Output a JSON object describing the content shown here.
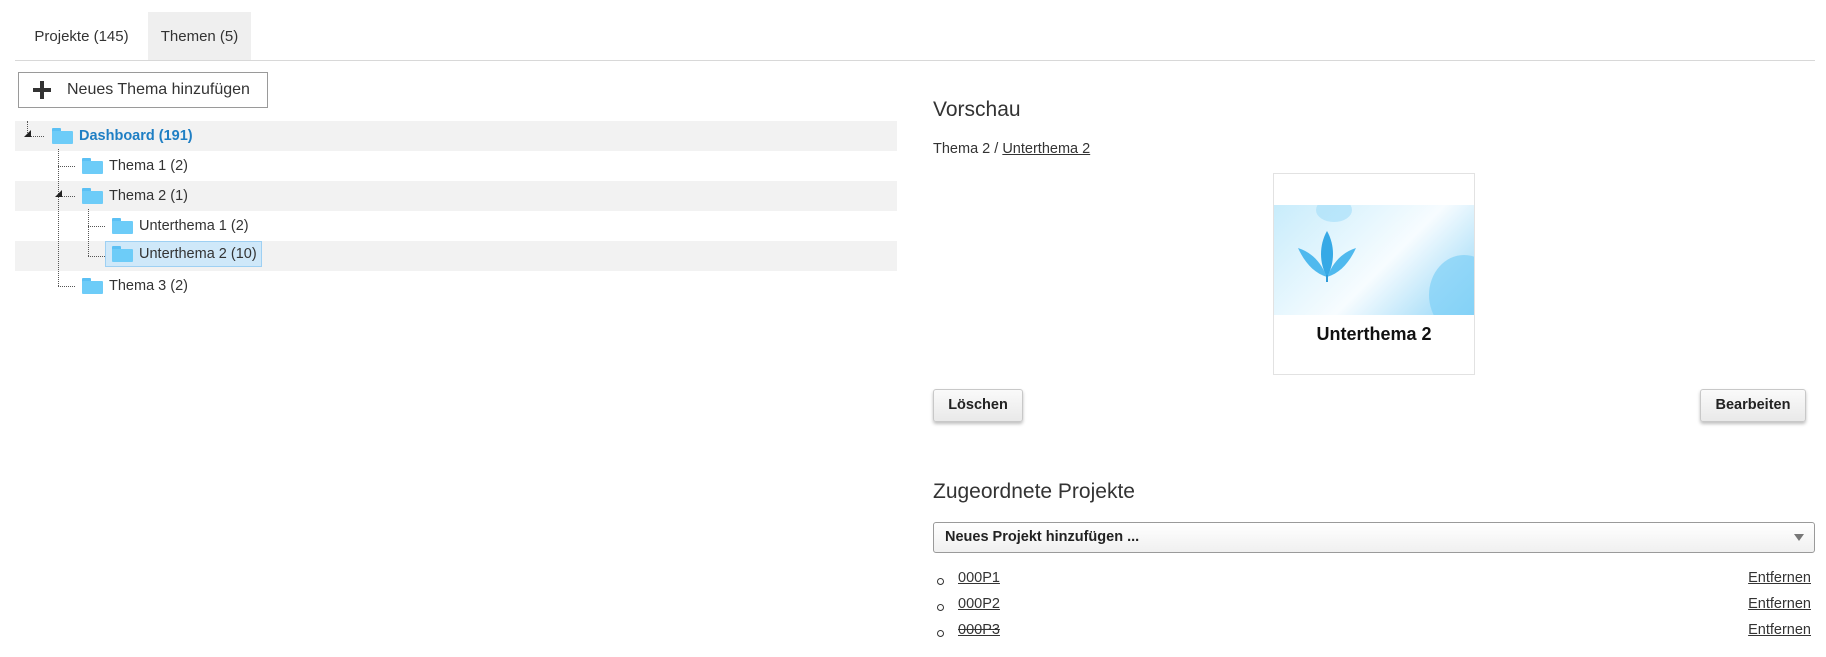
{
  "tabs": [
    {
      "label": "Projekte (145)"
    },
    {
      "label": "Themen (5)",
      "active": true
    }
  ],
  "add_topic_button": {
    "label": "Neues Thema hinzufügen"
  },
  "tree": {
    "root": {
      "label": "Dashboard (191)"
    },
    "nodes": [
      {
        "label": "Thema 1 (2)"
      },
      {
        "label": "Thema 2 (1)"
      },
      {
        "label": "Unterthema 1 (2)"
      },
      {
        "label": "Unterthema 2 (10)",
        "selected": true
      },
      {
        "label": "Thema 3 (2)"
      }
    ]
  },
  "preview": {
    "heading": "Vorschau",
    "breadcrumb": {
      "parent": "Thema 2",
      "separator": " / ",
      "current": "Unterthema 2"
    },
    "card_title": "Unterthema 2",
    "delete_label": "Löschen",
    "edit_label": "Bearbeiten"
  },
  "projects": {
    "heading": "Zugeordnete Projekte",
    "add_select": "Neues Projekt hinzufügen ...",
    "remove_label": "Entfernen",
    "items": [
      {
        "name": "000P1"
      },
      {
        "name": "000P2"
      },
      {
        "name": "000P3",
        "strikethrough": true
      }
    ]
  },
  "colors": {
    "folder": "#6dccf8",
    "root_link": "#1f7fc4",
    "selected_bg": "#cfe8f9"
  }
}
